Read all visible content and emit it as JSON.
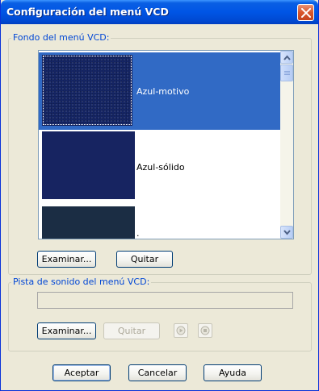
{
  "window": {
    "title": "Configuración del menú VCD"
  },
  "background_group": {
    "label": "Fondo del menú VCD:",
    "items": [
      {
        "label": "Azul-motivo",
        "swatch": "#16276a",
        "selected": true
      },
      {
        "label": "Azul-sólido",
        "swatch": "#172461",
        "selected": false
      },
      {
        "label": ".",
        "swatch": "#1b2d44",
        "selected": false
      }
    ],
    "browse_label": "Examinar...",
    "remove_label": "Quitar"
  },
  "soundtrack_group": {
    "label": "Pista de sonido del menú VCD:",
    "path_value": "",
    "browse_label": "Examinar...",
    "remove_label": "Quitar",
    "play_icon": "play-icon",
    "stop_icon": "stop-icon"
  },
  "footer": {
    "ok_label": "Aceptar",
    "cancel_label": "Cancelar",
    "help_label": "Ayuda"
  },
  "colors": {
    "titlebar": "#0055e5",
    "selection": "#316ac5",
    "group_label": "#0046d5",
    "dialog_bg": "#ece9d8"
  }
}
